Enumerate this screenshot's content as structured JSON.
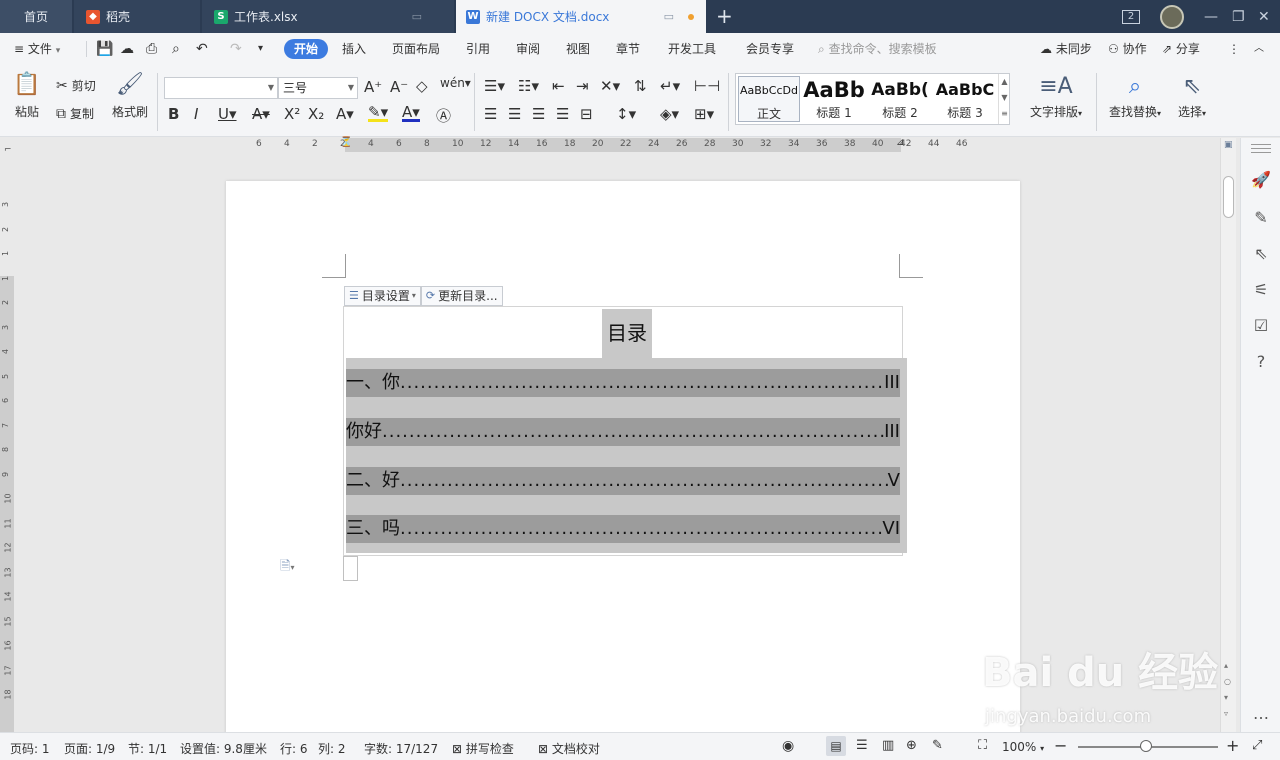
{
  "tabs": {
    "home": "首页",
    "items": [
      {
        "label": "稻壳",
        "icon": "daoke-icon",
        "color": "#e8552f"
      },
      {
        "label": "工作表.xlsx",
        "icon": "sheet-icon",
        "color": "#1aa86c"
      },
      {
        "label": "新建 DOCX 文档.docx",
        "icon": "writer-icon",
        "color": "#3a78d8",
        "active": true
      }
    ],
    "new_tab": "+",
    "window_badge": "2"
  },
  "menubar": {
    "file": "文件",
    "items": [
      "开始",
      "插入",
      "页面布局",
      "引用",
      "审阅",
      "视图",
      "章节",
      "开发工具",
      "会员专享"
    ],
    "active": "开始",
    "search_placeholder": "查找命令、搜索模板",
    "right": [
      "未同步",
      "协作",
      "分享"
    ]
  },
  "ribbon": {
    "paste": "粘贴",
    "cut": "剪切",
    "copy": "复制",
    "format_painter": "格式刷",
    "font_name": "",
    "font_size": "三号",
    "styles": [
      {
        "sample": "AaBbCcDd",
        "name": "正文"
      },
      {
        "sample": "AaBb",
        "name": "标题 1"
      },
      {
        "sample": "AaBb(",
        "name": "标题 2"
      },
      {
        "sample": "AaBbC",
        "name": "标题 3"
      }
    ],
    "text_layout": "文字排版",
    "find_replace": "查找替换",
    "select": "选择"
  },
  "ruler": {
    "h_ticks": [
      "6",
      "4",
      "2",
      "2",
      "4",
      "6",
      "8",
      "10",
      "12",
      "14",
      "16",
      "18",
      "20",
      "22",
      "24",
      "26",
      "28",
      "30",
      "32",
      "34",
      "36",
      "38",
      "40",
      "42",
      "44",
      "46"
    ],
    "v_ticks": [
      "3",
      "2",
      "1",
      "1",
      "2",
      "3",
      "4",
      "5",
      "6",
      "7",
      "8",
      "9",
      "10",
      "11",
      "12",
      "13",
      "14",
      "15",
      "16",
      "17",
      "18"
    ]
  },
  "toc": {
    "settings_btn": "目录设置",
    "update_btn": "更新目录...",
    "title": "目录",
    "entries": [
      {
        "text": "一、你",
        "page": "III"
      },
      {
        "text": "你好",
        "page": "III"
      },
      {
        "text": "二、好",
        "page": "V"
      },
      {
        "text": "三、吗",
        "page": "VI"
      }
    ]
  },
  "status": {
    "page_no": "页码: 1",
    "pages": "页面: 1/9",
    "section": "节: 1/1",
    "setting": "设置值: 9.8厘米",
    "row": "行: 6",
    "col": "列: 2",
    "words": "字数: 17/127",
    "spell": "拼写检查",
    "proof": "文档校对",
    "zoom": "100%"
  },
  "watermark": {
    "logo": "Bai du 经验",
    "url": "jingyan.baidu.com"
  }
}
